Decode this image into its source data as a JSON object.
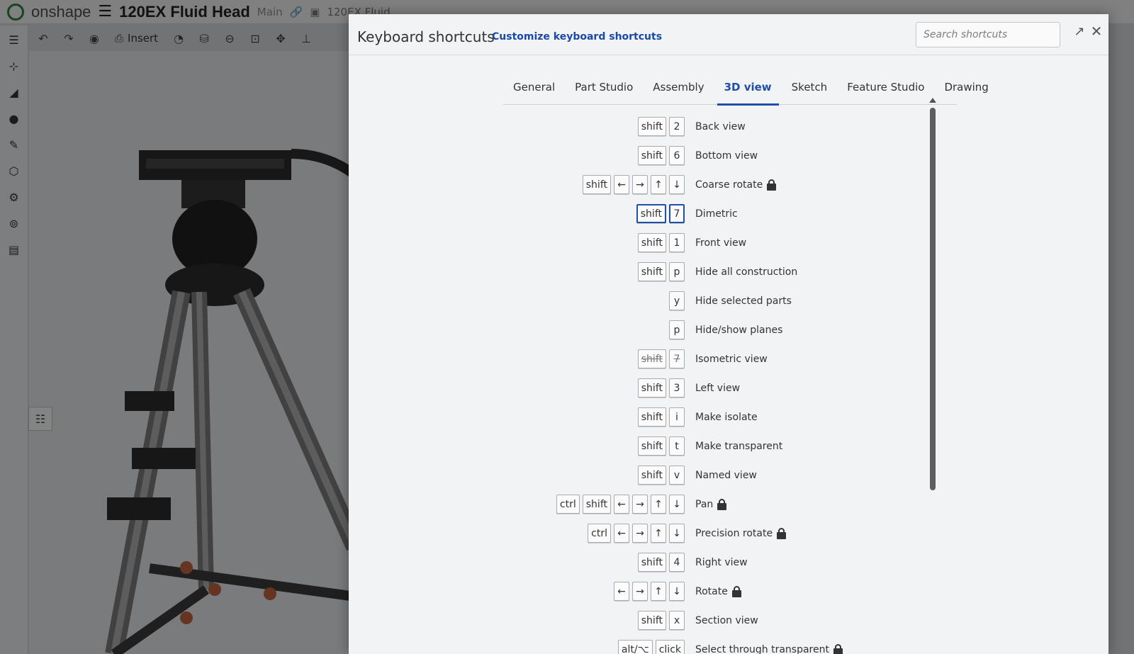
{
  "app": {
    "logo_text": "onshape",
    "doc_title": "120EX Fluid Head",
    "branch": "Main",
    "tab_name": "120EX Fluid ...",
    "insert_label": "Insert"
  },
  "dialog": {
    "title": "Keyboard shortcuts",
    "customize_link": "Customize keyboard shortcuts",
    "search_placeholder": "Search shortcuts",
    "tabs": [
      {
        "label": "General"
      },
      {
        "label": "Part Studio"
      },
      {
        "label": "Assembly"
      },
      {
        "label": "3D view",
        "active": true
      },
      {
        "label": "Sketch"
      },
      {
        "label": "Feature Studio"
      },
      {
        "label": "Drawing"
      }
    ],
    "shortcuts": [
      {
        "keys": [
          "shift",
          "2"
        ],
        "action": "Back view"
      },
      {
        "keys": [
          "shift",
          "6"
        ],
        "action": "Bottom view"
      },
      {
        "keys": [
          "shift",
          "←",
          "→",
          "↑",
          "↓"
        ],
        "action": "Coarse rotate",
        "locked": true
      },
      {
        "keys": [
          "shift",
          "7"
        ],
        "action": "Dimetric",
        "highlight": true
      },
      {
        "keys": [
          "shift",
          "1"
        ],
        "action": "Front view"
      },
      {
        "keys": [
          "shift",
          "p"
        ],
        "action": "Hide all construction"
      },
      {
        "keys": [
          "y"
        ],
        "action": "Hide selected parts"
      },
      {
        "keys": [
          "p"
        ],
        "action": "Hide/show planes"
      },
      {
        "keys": [
          "shift",
          "7"
        ],
        "action": "Isometric view",
        "struck": true
      },
      {
        "keys": [
          "shift",
          "3"
        ],
        "action": "Left view"
      },
      {
        "keys": [
          "shift",
          "i"
        ],
        "action": "Make isolate"
      },
      {
        "keys": [
          "shift",
          "t"
        ],
        "action": "Make transparent"
      },
      {
        "keys": [
          "shift",
          "v"
        ],
        "action": "Named view"
      },
      {
        "keys": [
          "ctrl",
          "shift",
          "←",
          "→",
          "↑",
          "↓"
        ],
        "action": "Pan",
        "locked": true
      },
      {
        "keys": [
          "ctrl",
          "←",
          "→",
          "↑",
          "↓"
        ],
        "action": "Precision rotate",
        "locked": true
      },
      {
        "keys": [
          "shift",
          "4"
        ],
        "action": "Right view"
      },
      {
        "keys": [
          "←",
          "→",
          "↑",
          "↓"
        ],
        "action": "Rotate",
        "locked": true
      },
      {
        "keys": [
          "shift",
          "x"
        ],
        "action": "Section view"
      },
      {
        "keys": [
          "alt/⌥",
          "click"
        ],
        "action": "Select through transparent",
        "locked": true
      }
    ]
  },
  "colors": {
    "accent": "#1f4fa8",
    "brand": "#2b7a3a"
  }
}
